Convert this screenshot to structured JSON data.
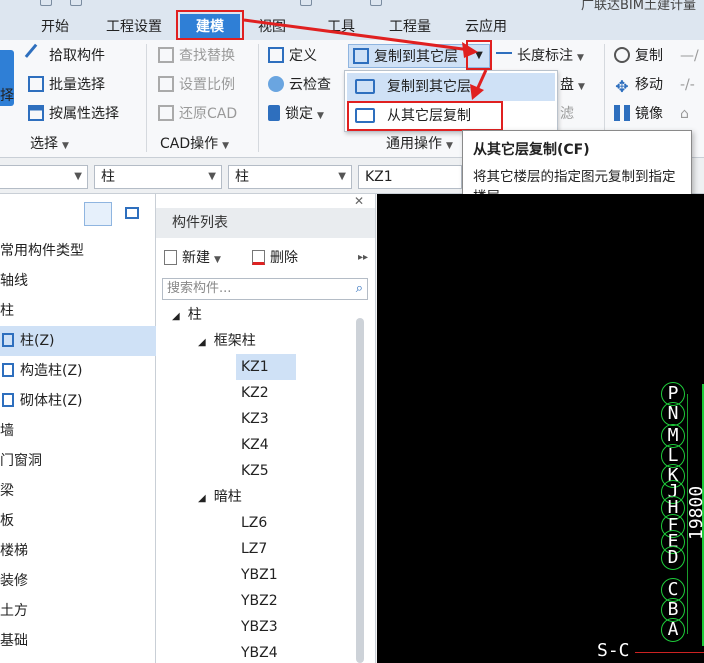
{
  "window": {
    "title": "广联达BIM土建计量"
  },
  "menu": {
    "tabs": [
      {
        "label": "开始"
      },
      {
        "label": "工程设置"
      },
      {
        "label": "建模"
      },
      {
        "label": "视图"
      },
      {
        "label": "工具"
      },
      {
        "label": "工程量"
      },
      {
        "label": "云应用"
      }
    ]
  },
  "ribbon": {
    "select_group": {
      "label": "选择",
      "partial_button": "择",
      "items": [
        "拾取构件",
        "批量选择",
        "按属性选择"
      ]
    },
    "cad_group": {
      "label": "CAD操作",
      "items": [
        "查找替换",
        "设置比例",
        "还原CAD"
      ]
    },
    "common_group": {
      "label": "通用操作",
      "items": [
        "定义",
        "云检查",
        "锁定"
      ],
      "copy_to_layer": "复制到其它层",
      "length_mark": "长度标注",
      "partial_1": "盘",
      "partial_2": "滤"
    },
    "modify_group": {
      "items": [
        "复制",
        "移动",
        "镜像"
      ]
    }
  },
  "dropdown": {
    "items": [
      {
        "label": "复制到其它层"
      },
      {
        "label": "从其它层复制"
      }
    ]
  },
  "tooltip": {
    "title": "从其它层复制(CF)",
    "body": "将其它楼层的指定图元复制到指定楼层"
  },
  "filterbar": {
    "combo1": "",
    "combo2": "柱",
    "combo3": "柱",
    "combo4": "KZ1"
  },
  "left_tree": {
    "items": [
      {
        "label": "常用构件类型"
      },
      {
        "label": "轴线"
      },
      {
        "label": "柱"
      },
      {
        "label": "柱(Z)"
      },
      {
        "label": "构造柱(Z)"
      },
      {
        "label": "砌体柱(Z)"
      },
      {
        "label": "墙"
      },
      {
        "label": "门窗洞"
      },
      {
        "label": "梁"
      },
      {
        "label": "板"
      },
      {
        "label": "楼梯"
      },
      {
        "label": "装修"
      },
      {
        "label": "土方"
      },
      {
        "label": "基础"
      }
    ]
  },
  "component_list": {
    "header": "构件列表",
    "new_label": "新建",
    "delete_label": "删除",
    "search_placeholder": "搜索构件...",
    "root": "柱",
    "groups": [
      {
        "name": "框架柱",
        "items": [
          "KZ1",
          "KZ2",
          "KZ3",
          "KZ4",
          "KZ5"
        ]
      },
      {
        "name": "暗柱",
        "items": [
          "LZ6",
          "LZ7",
          "YBZ1",
          "YBZ2",
          "YBZ3",
          "YBZ4"
        ]
      }
    ]
  },
  "canvas": {
    "axis_labels": [
      "P",
      "N",
      "M",
      "L",
      "K",
      "J",
      "H",
      "F",
      "E",
      "D",
      "C",
      "B",
      "A"
    ],
    "dimension": "19800",
    "section_label": "S-C"
  },
  "colors": {
    "accent": "#2f7fd6",
    "highlight": "#cfe1f6",
    "annotation_red": "#e02020",
    "axis_green": "#1ecb3a"
  }
}
